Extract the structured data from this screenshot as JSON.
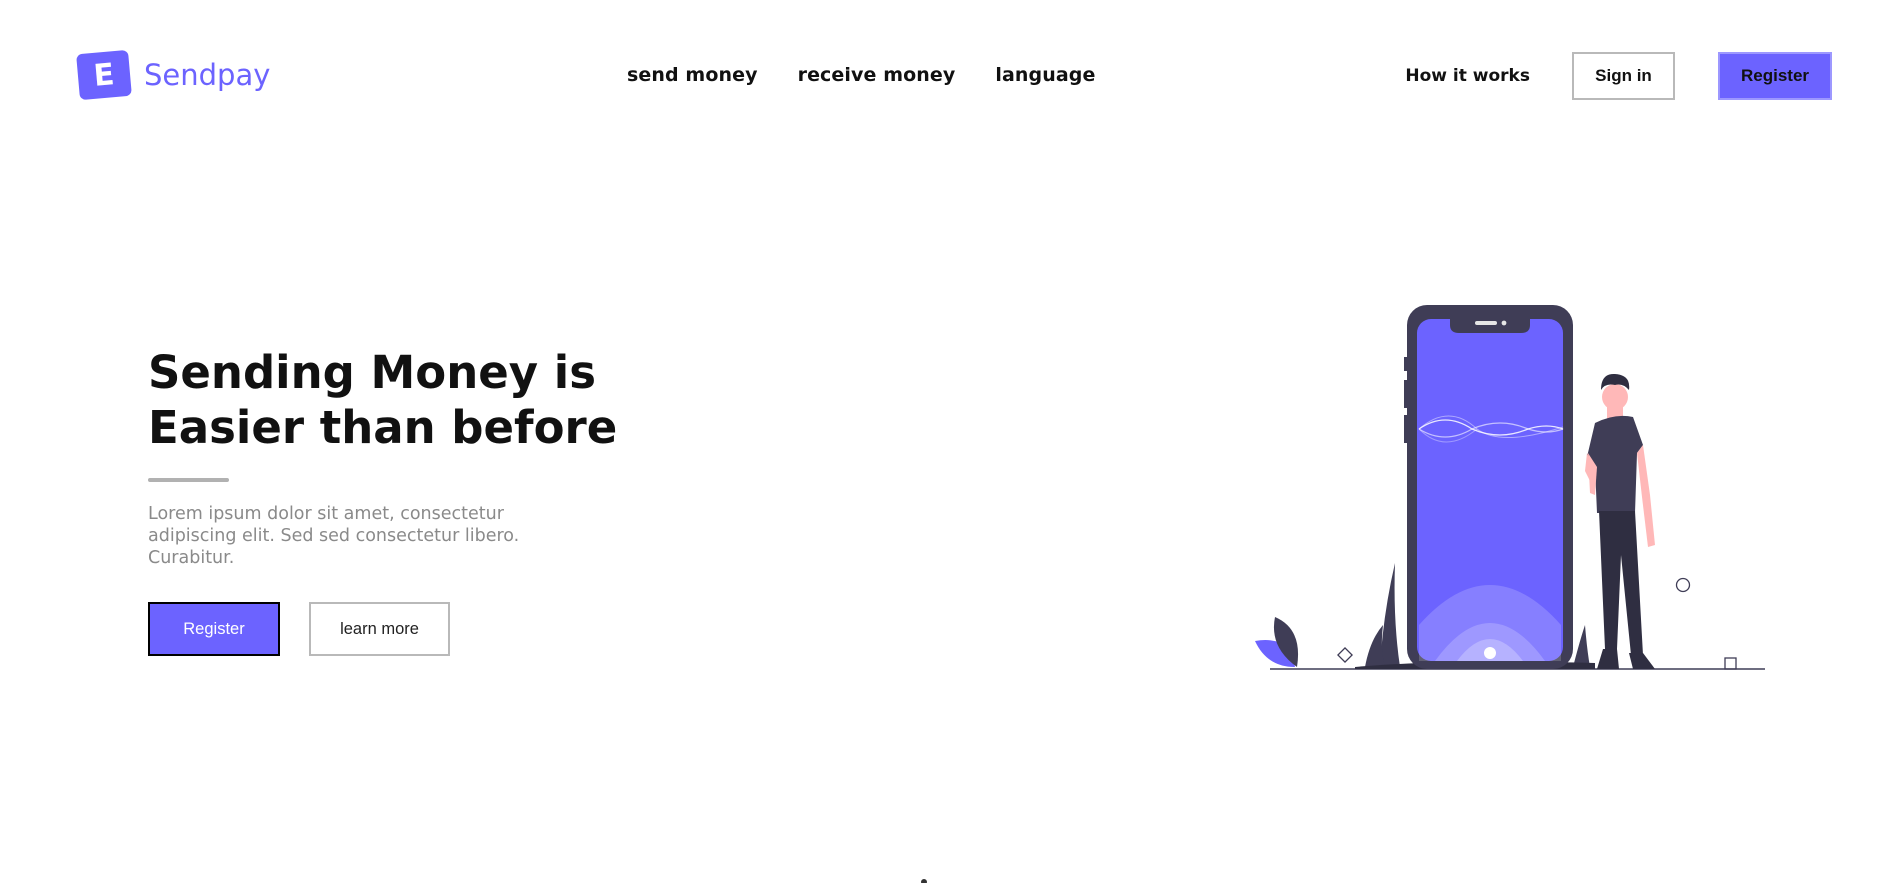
{
  "brand": {
    "logo_letter": "E",
    "name": "Sendpay",
    "accent": "#6c63ff"
  },
  "nav": {
    "items": [
      "send money",
      "receive money",
      "language"
    ]
  },
  "right_nav": {
    "how_it_works": "How it works",
    "sign_in": "Sign in",
    "register": "Register"
  },
  "hero": {
    "title_line1": "Sending Money is",
    "title_line2": "Easier than before",
    "description": "Lorem ipsum dolor sit amet, consectetur adipiscing elit. Sed sed consectetur libero. Curabitur.",
    "register_label": "Register",
    "learn_more_label": "learn more"
  },
  "colors": {
    "primary": "#6c63ff",
    "dark": "#3f3d56",
    "skin": "#ffb8b8"
  },
  "icons": {
    "logo": "sendpay-logo-icon",
    "illustration": "phone-person-illustration"
  }
}
